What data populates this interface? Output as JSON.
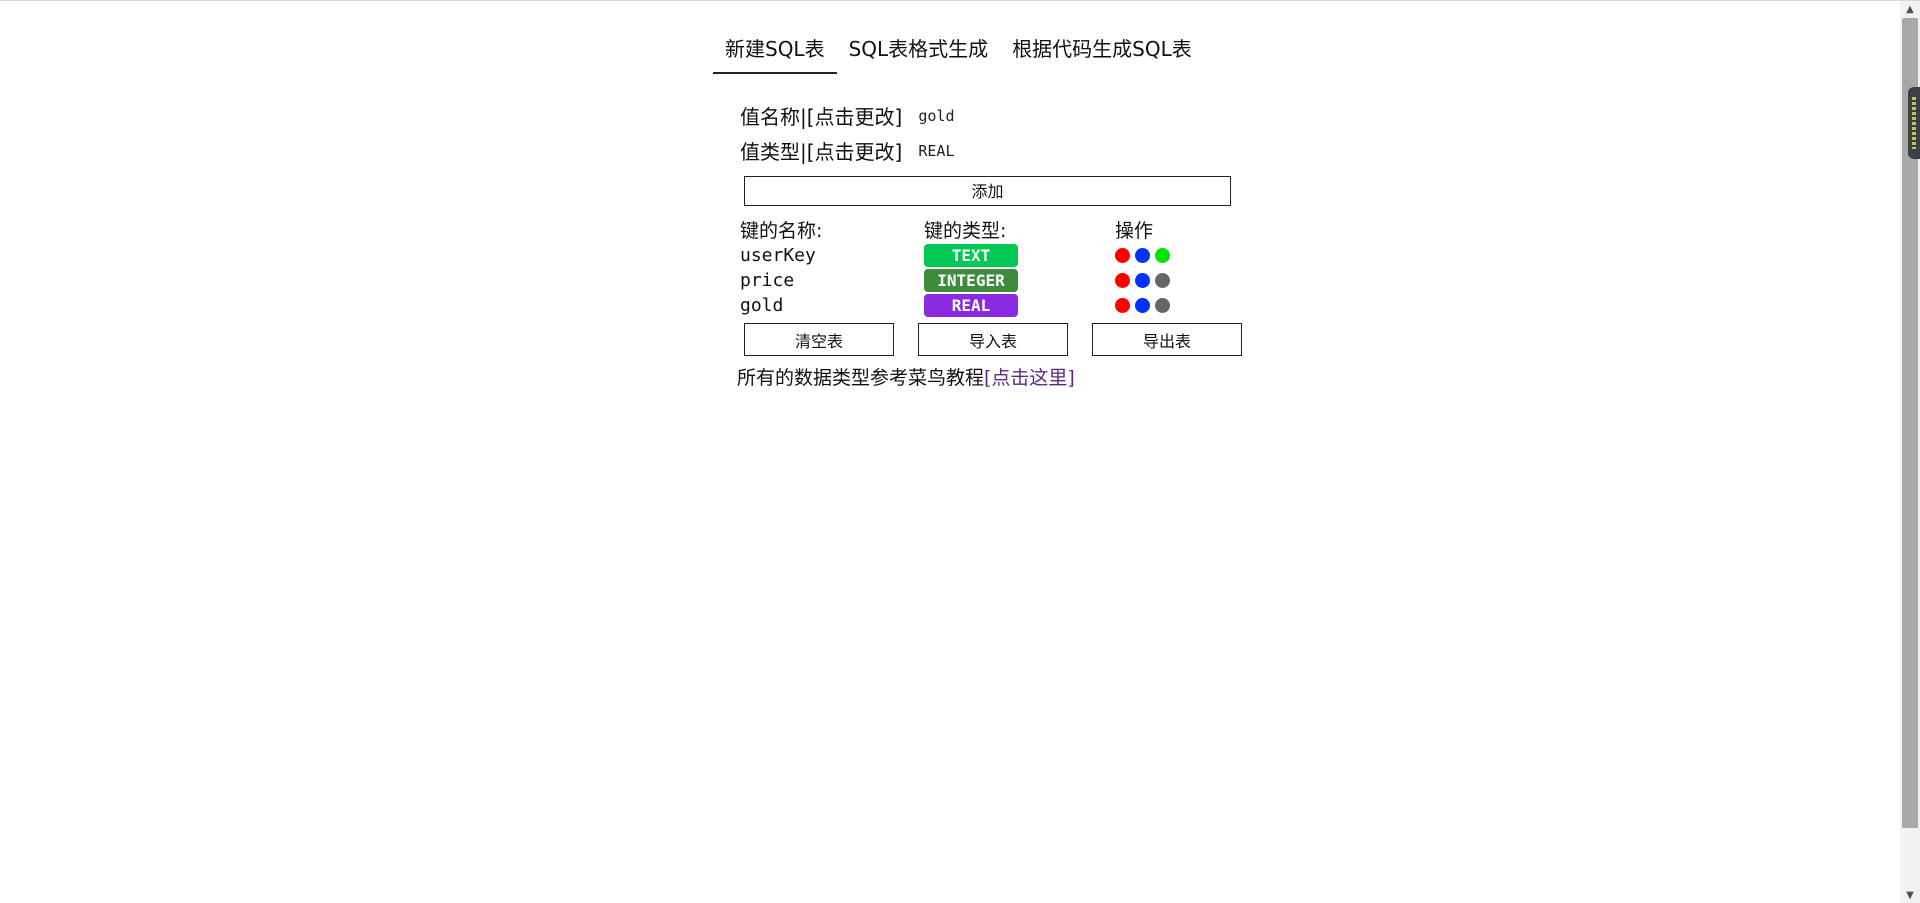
{
  "tabs": [
    {
      "label": "新建SQL表",
      "active": true
    },
    {
      "label": "SQL表格式生成",
      "active": false
    },
    {
      "label": "根据代码生成SQL表",
      "active": false
    }
  ],
  "form": {
    "name_label": "值名称|",
    "name_change": "[点击更改]",
    "name_value": "gold",
    "type_label": "值类型|",
    "type_change": "[点击更改]",
    "type_value": "REAL",
    "add_label": "添加"
  },
  "table": {
    "headers": {
      "name": "键的名称:",
      "type": "键的类型:",
      "ops": "操作"
    },
    "rows": [
      {
        "name": "userKey",
        "type": "TEXT",
        "type_color": "#00c853",
        "dots": [
          "#ff0000",
          "#0033ff",
          "#00e600"
        ]
      },
      {
        "name": "price",
        "type": "INTEGER",
        "type_color": "#3c8c3c",
        "dots": [
          "#ff0000",
          "#0033ff",
          "#666666"
        ]
      },
      {
        "name": "gold",
        "type": "REAL",
        "type_color": "#8a2be2",
        "dots": [
          "#ff0000",
          "#0033ff",
          "#666666"
        ]
      }
    ]
  },
  "buttons": {
    "clear": "清空表",
    "import": "导入表",
    "export": "导出表"
  },
  "reference": {
    "text": "所有的数据类型参考菜鸟教程",
    "link": "[点击这里]",
    "link_color": "#5b2a86"
  },
  "scrollbar": {
    "up_icon": "▲",
    "down_icon": "▼"
  }
}
